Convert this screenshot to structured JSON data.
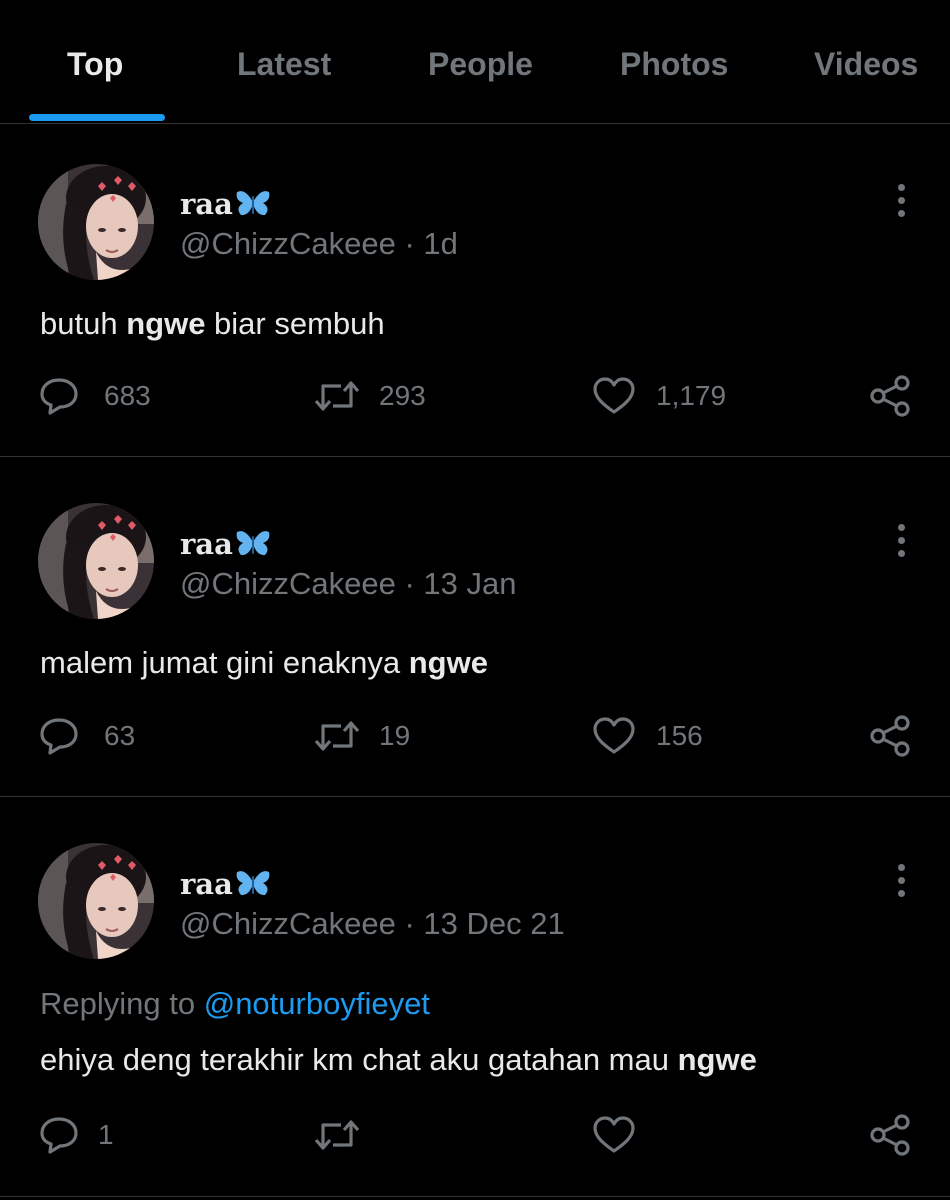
{
  "tabs": [
    {
      "label": "Top",
      "active": true
    },
    {
      "label": "Latest",
      "active": false
    },
    {
      "label": "People",
      "active": false
    },
    {
      "label": "Photos",
      "active": false
    },
    {
      "label": "Videos",
      "active": false
    }
  ],
  "colors": {
    "background": "#000000",
    "text_primary": "#e7e9ea",
    "text_secondary": "#71767b",
    "accent": "#1d9bf0",
    "divider": "#2f3336"
  },
  "tweets": [
    {
      "display_name": "raa",
      "name_emoji": "butterfly-icon",
      "handle": "@ChizzCakeee",
      "time": "1d",
      "text_before": "butuh ",
      "text_bold": "ngwe",
      "text_after": " biar sembuh",
      "replies": "683",
      "retweets": "293",
      "likes": "1,179"
    },
    {
      "display_name": "raa",
      "name_emoji": "butterfly-icon",
      "handle": "@ChizzCakeee",
      "time": "13 Jan",
      "text_before": "malem jumat gini enaknya ",
      "text_bold": "ngwe",
      "text_after": "",
      "replies": "63",
      "retweets": "19",
      "likes": "156"
    },
    {
      "display_name": "raa",
      "name_emoji": "butterfly-icon",
      "handle": "@ChizzCakeee",
      "time": "13 Dec 21",
      "replying_label": "Replying to ",
      "replying_to": "@noturboyfieyet",
      "text_before": "ehiya deng terakhir km chat aku gatahan mau ",
      "text_bold": "ngwe",
      "text_after": "",
      "replies": "1",
      "retweets": "",
      "likes": ""
    }
  ]
}
